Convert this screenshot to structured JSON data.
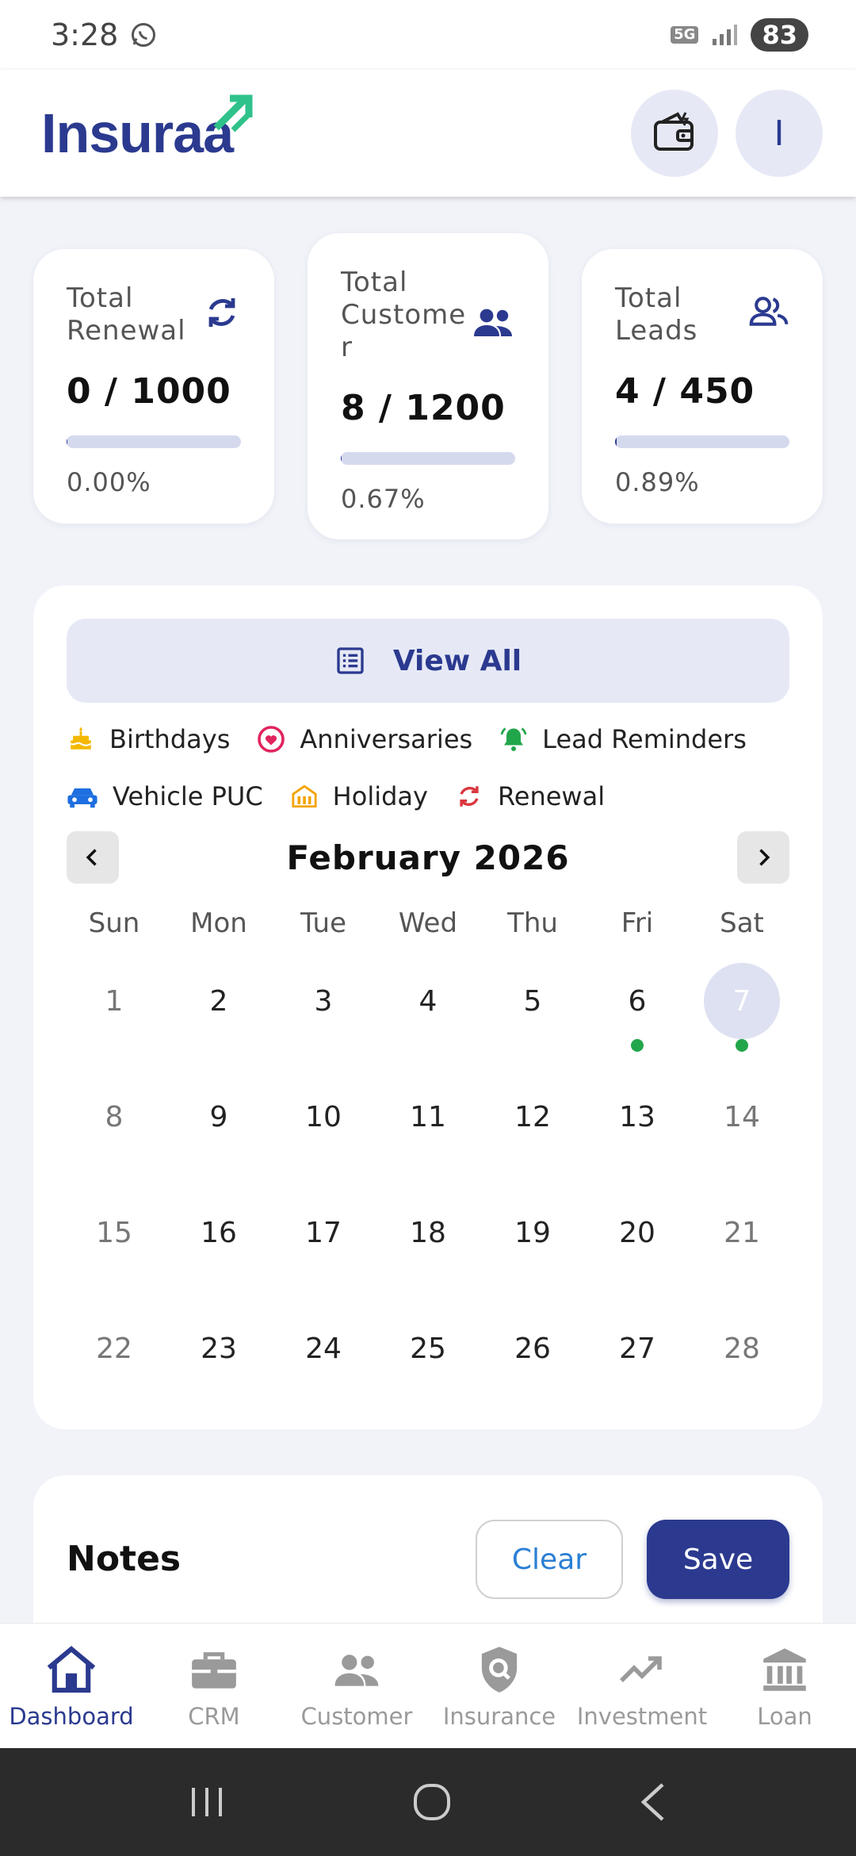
{
  "status": {
    "time": "3:28",
    "network": "5G",
    "battery": "83"
  },
  "header": {
    "logo": "Insuraa",
    "avatar_letter": "I"
  },
  "stats": [
    {
      "label": "Total Renewal",
      "value": "0 / 1000",
      "percent": "0.00%",
      "progress": 0.0,
      "icon": "refresh-icon"
    },
    {
      "label": "Total Custome r",
      "value": "8 / 1200",
      "percent": "0.67%",
      "progress": 0.67,
      "icon": "users-icon"
    },
    {
      "label": "Total Leads",
      "value": "4 / 450",
      "percent": "0.89%",
      "progress": 0.89,
      "icon": "people-outline-icon"
    }
  ],
  "calendar": {
    "view_all": "View All",
    "legend": [
      {
        "label": "Birthdays",
        "icon": "cake-icon",
        "color": "#f5b800"
      },
      {
        "label": "Anniversaries",
        "icon": "heart-icon",
        "color": "#e0245e"
      },
      {
        "label": "Lead Reminders",
        "icon": "bell-icon",
        "color": "#22a64b"
      },
      {
        "label": "Vehicle PUC",
        "icon": "car-icon",
        "color": "#1e6fe0"
      },
      {
        "label": "Holiday",
        "icon": "building-icon",
        "color": "#f5a300"
      },
      {
        "label": "Renewal",
        "icon": "refresh-icon",
        "color": "#d9363e"
      }
    ],
    "month": "February 2026",
    "weekdays": [
      "Sun",
      "Mon",
      "Tue",
      "Wed",
      "Thu",
      "Fri",
      "Sat"
    ],
    "today": 7,
    "event_days": [
      6,
      7
    ],
    "days": [
      "1",
      "2",
      "3",
      "4",
      "5",
      "6",
      "7",
      "8",
      "9",
      "10",
      "11",
      "12",
      "13",
      "14",
      "15",
      "16",
      "17",
      "18",
      "19",
      "20",
      "21",
      "22",
      "23",
      "24",
      "25",
      "26",
      "27",
      "28"
    ]
  },
  "notes": {
    "title": "Notes",
    "clear": "Clear",
    "save": "Save"
  },
  "bottom_nav": [
    {
      "label": "Dashboard",
      "icon": "home-icon",
      "active": true
    },
    {
      "label": "CRM",
      "icon": "briefcase-icon",
      "active": false
    },
    {
      "label": "Customer",
      "icon": "customer-icon",
      "active": false
    },
    {
      "label": "Insurance",
      "icon": "shield-icon",
      "active": false
    },
    {
      "label": "Investment",
      "icon": "trend-icon",
      "active": false
    },
    {
      "label": "Loan",
      "icon": "bank-icon",
      "active": false
    }
  ],
  "colors": {
    "brand": "#2b3a8f",
    "accent": "#2fc28a",
    "event_dot": "#22a64b"
  }
}
